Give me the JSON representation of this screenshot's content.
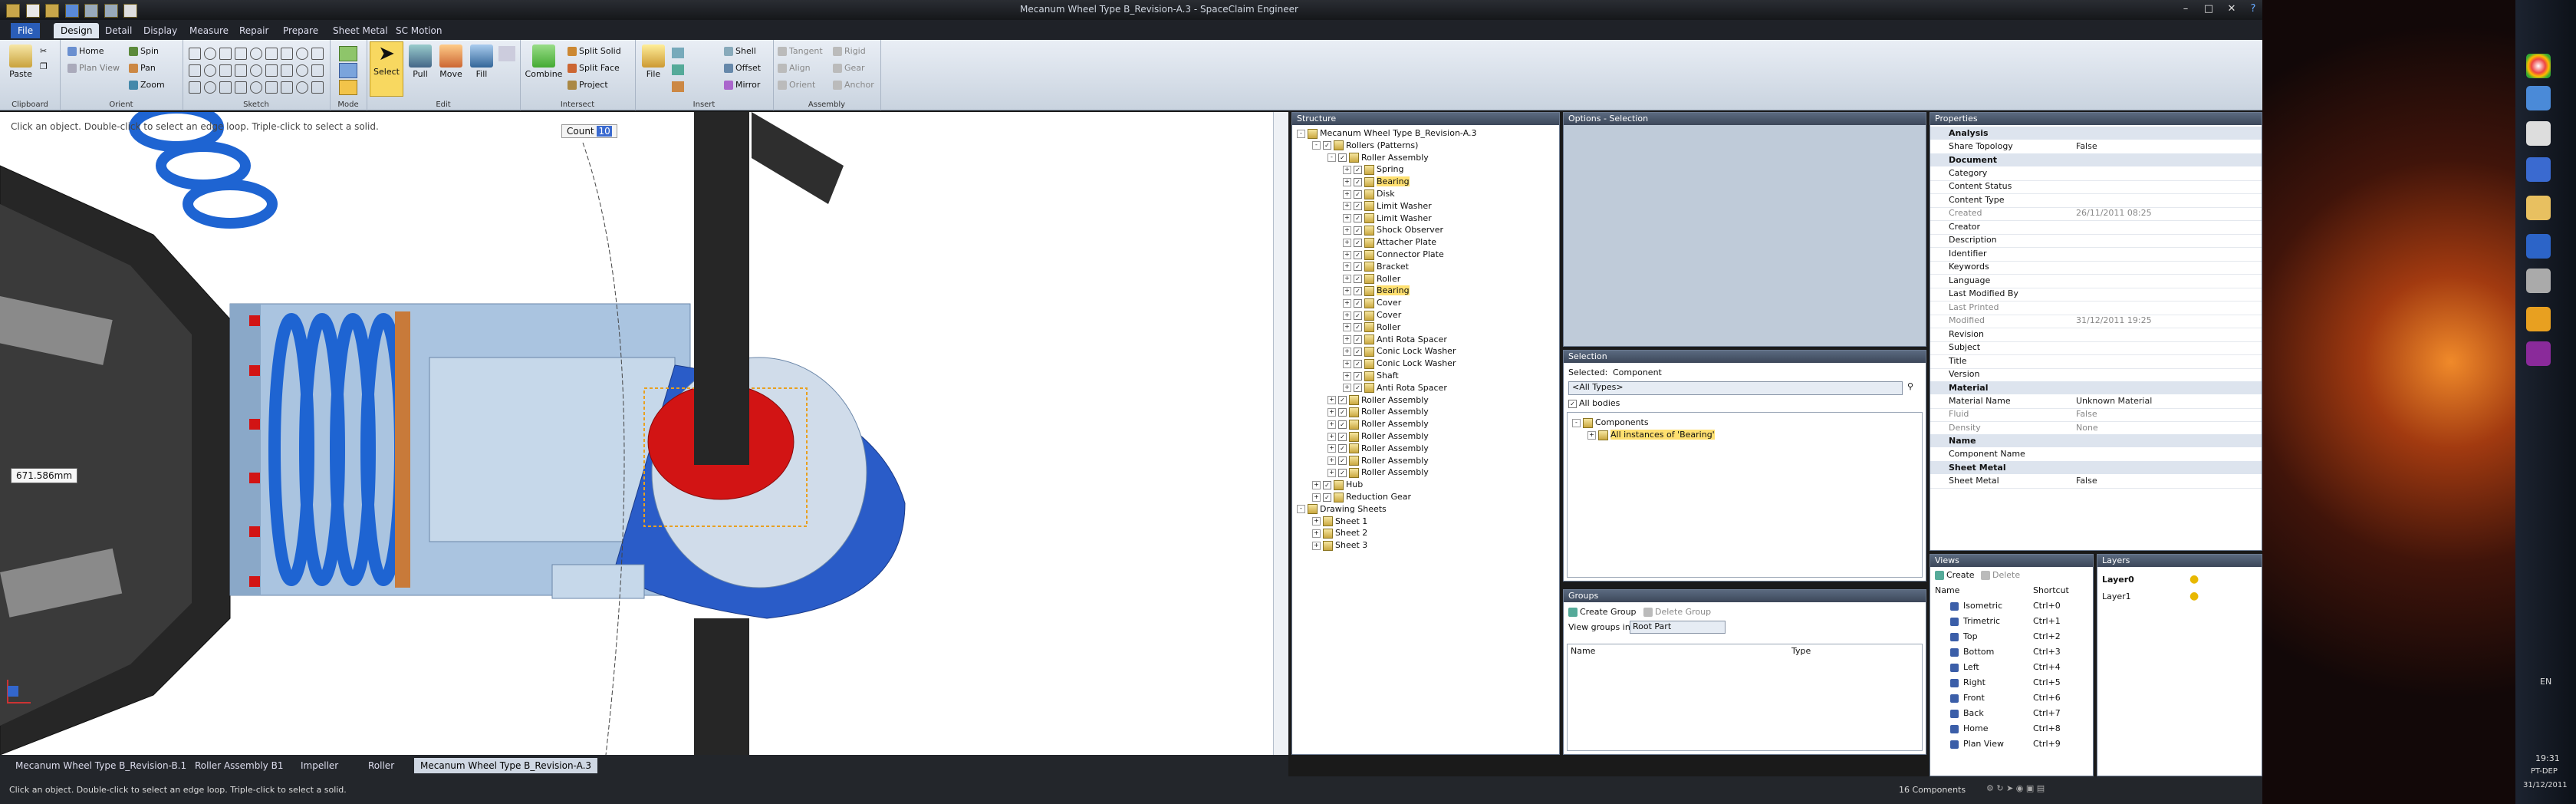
{
  "window": {
    "title": "Mecanum Wheel Type B_Revision-A.3 - SpaceClaim Engineer"
  },
  "menu_tabs": [
    "File",
    "Design",
    "Detail",
    "Display",
    "Measure",
    "Repair",
    "Prepare",
    "Sheet Metal",
    "SC Motion"
  ],
  "ribbon": {
    "clipboard": {
      "label": "Clipboard",
      "paste": "Paste"
    },
    "orient": {
      "label": "Orient",
      "home": "Home",
      "spin": "Spin",
      "plan_view": "Plan View",
      "pan": "Pan",
      "zoom": "Zoom"
    },
    "sketch": {
      "label": "Sketch"
    },
    "mode": {
      "label": "Mode"
    },
    "edit": {
      "label": "Edit",
      "select": "Select",
      "pull": "Pull",
      "move": "Move",
      "fill": "Fill"
    },
    "intersect": {
      "label": "Intersect",
      "combine": "Combine",
      "split_solid": "Split Solid",
      "split_face": "Split Face",
      "project": "Project"
    },
    "insert": {
      "label": "Insert",
      "file": "File",
      "shell": "Shell",
      "offset": "Offset",
      "mirror": "Mirror"
    },
    "assembly": {
      "label": "Assembly",
      "tangent": "Tangent",
      "align": "Align",
      "orient": "Orient",
      "rigid": "Rigid",
      "gear": "Gear",
      "anchor": "Anchor"
    }
  },
  "viewport": {
    "hint": "Click an object. Double-click to select an edge loop. Triple-click to select a solid.",
    "count_label": "Count",
    "count_value": "10",
    "dimension": "671.586mm",
    "colors": {
      "tube": "#aac4e0",
      "spring": "#1e64d2",
      "red": "#d21414",
      "plate": "#2a5cc8",
      "dark": "#262626"
    }
  },
  "doc_tabs": [
    "Mecanum Wheel Type B_Revision-B.1",
    "Roller Assembly B1",
    "Impeller",
    "Roller",
    "Mecanum Wheel Type B_Revision-A.3"
  ],
  "structure": {
    "header": "Structure",
    "root": "Mecanum Wheel Type B_Revision-A.3",
    "rollers": "Rollers (Patterns)",
    "assembly": "Roller Assembly",
    "children": [
      "Spring",
      "Bearing",
      "Disk",
      "Limit Washer",
      "Limit Washer",
      "Shock Observer",
      "Attacher Plate",
      "Connector Plate",
      "Bracket",
      "Roller",
      "Bearing",
      "Cover",
      "Cover",
      "Roller",
      "Anti Rota Spacer",
      "Conic Lock Washer",
      "Conic Lock Washer",
      "Shaft",
      "Anti Rota Spacer"
    ],
    "more_assemblies": [
      "Roller Assembly",
      "Roller Assembly",
      "Roller Assembly",
      "Roller Assembly",
      "Roller Assembly",
      "Roller Assembly",
      "Roller Assembly"
    ],
    "hub": "Hub",
    "reduction_gear": "Reduction Gear",
    "drawing_sheets": "Drawing Sheets",
    "sheets": [
      "Sheet 1",
      "Sheet 2",
      "Sheet 3"
    ]
  },
  "options_panel": {
    "header": "Options - Selection"
  },
  "selection_panel": {
    "header": "Selection",
    "selected_label": "Selected:",
    "selected_value": "Component",
    "filter": "<All Types>",
    "all_bodies": "All bodies",
    "components": "Components",
    "instances": "All instances of 'Bearing'"
  },
  "groups_panel": {
    "header": "Groups",
    "create": "Create Group",
    "delete": "Delete Group",
    "view_in": "View groups in:",
    "view_in_value": "Root Part",
    "col_name": "Name",
    "col_type": "Type"
  },
  "properties": {
    "header": "Properties",
    "sections": [
      {
        "name": "Analysis",
        "rows": [
          [
            "Share Topology",
            "False"
          ]
        ]
      },
      {
        "name": "Document",
        "rows": [
          [
            "Category",
            ""
          ],
          [
            "Content Status",
            ""
          ],
          [
            "Content Type",
            ""
          ],
          [
            "Created",
            "26/11/2011 08:25"
          ],
          [
            "Creator",
            ""
          ],
          [
            "Description",
            ""
          ],
          [
            "Identifier",
            ""
          ],
          [
            "Keywords",
            ""
          ],
          [
            "Language",
            ""
          ],
          [
            "Last Modified By",
            ""
          ],
          [
            "Last Printed",
            ""
          ],
          [
            "Modified",
            "31/12/2011 19:25"
          ],
          [
            "Revision",
            ""
          ],
          [
            "Subject",
            ""
          ],
          [
            "Title",
            ""
          ],
          [
            "Version",
            ""
          ]
        ]
      },
      {
        "name": "Material",
        "rows": [
          [
            "Material Name",
            "Unknown Material"
          ],
          [
            "Fluid",
            "False"
          ],
          [
            "Density",
            "None"
          ]
        ]
      },
      {
        "name": "Name",
        "rows": [
          [
            "Component Name",
            ""
          ]
        ]
      },
      {
        "name": "Sheet Metal",
        "rows": [
          [
            "Sheet Metal",
            "False"
          ]
        ]
      }
    ]
  },
  "views_panel": {
    "header": "Views",
    "create": "Create",
    "delete": "Delete",
    "col_name": "Name",
    "col_shortcut": "Shortcut",
    "rows": [
      [
        "Isometric",
        "Ctrl+0"
      ],
      [
        "Trimetric",
        "Ctrl+1"
      ],
      [
        "Top",
        "Ctrl+2"
      ],
      [
        "Bottom",
        "Ctrl+3"
      ],
      [
        "Left",
        "Ctrl+4"
      ],
      [
        "Right",
        "Ctrl+5"
      ],
      [
        "Front",
        "Ctrl+6"
      ],
      [
        "Back",
        "Ctrl+7"
      ],
      [
        "Home",
        "Ctrl+8"
      ],
      [
        "Plan View",
        "Ctrl+9"
      ]
    ]
  },
  "layers_panel": {
    "header": "Layers",
    "layers": [
      "Layer0",
      "Layer1"
    ]
  },
  "status": {
    "message": "Click an object. Double-click to select an edge loop. Triple-click to select a solid.",
    "components": "16 Components"
  },
  "tray": {
    "lang": "EN",
    "time": "19:31",
    "day": "PT-DEP",
    "date": "31/12/2011"
  }
}
